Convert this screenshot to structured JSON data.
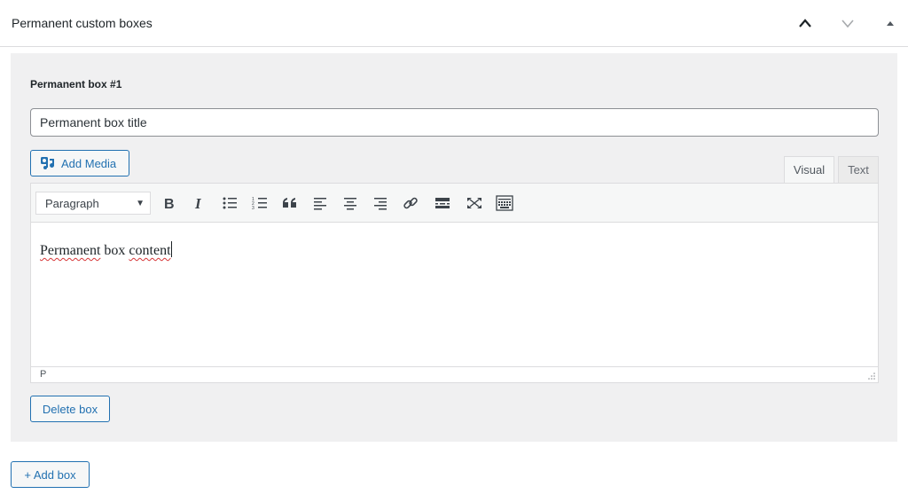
{
  "metabox": {
    "title": "Permanent custom boxes",
    "icons": {
      "move_up": "chevron-up-icon",
      "move_down": "chevron-down-icon",
      "toggle": "triangle-up-icon"
    }
  },
  "box": {
    "heading": "Permanent box #1",
    "title_value": "Permanent box title",
    "add_media_label": "Add Media",
    "tabs": {
      "visual": "Visual",
      "text": "Text"
    },
    "format_select_value": "Paragraph",
    "toolbar_icons": [
      "bold-icon",
      "italic-icon",
      "bulleted-list-icon",
      "numbered-list-icon",
      "blockquote-icon",
      "align-left-icon",
      "align-center-icon",
      "align-right-icon",
      "link-icon",
      "read-more-icon",
      "fullscreen-icon",
      "toolbar-toggle-icon"
    ],
    "content": {
      "word1": "Permanent",
      "word2": "box",
      "word3": "content"
    },
    "path": "P",
    "delete_label": "Delete box"
  },
  "add_box_label": "+ Add box",
  "colors": {
    "accent": "#2271b1",
    "panel_bg": "#f0f0f1",
    "spellcheck": "#d63638"
  }
}
